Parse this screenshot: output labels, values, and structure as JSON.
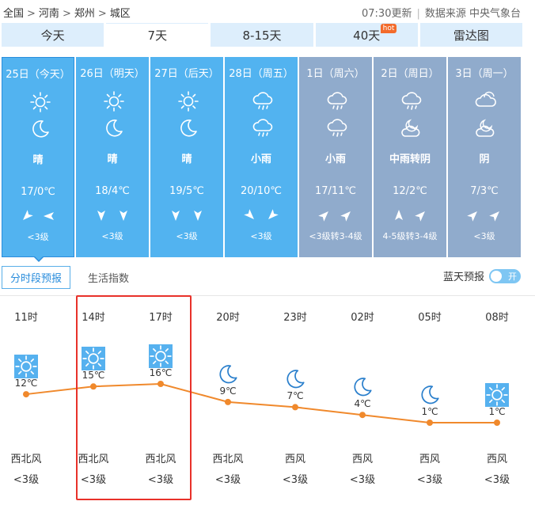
{
  "breadcrumb": [
    "全国",
    "河南",
    "郑州",
    "城区"
  ],
  "update_time": "07:30更新",
  "source": "数据来源 中央气象台",
  "tabs": [
    {
      "label": "今天",
      "active": false
    },
    {
      "label": "7天",
      "active": true
    },
    {
      "label": "8-15天",
      "active": false
    },
    {
      "label": "40天",
      "active": false,
      "badge": "hot"
    },
    {
      "label": "雷达图",
      "active": false
    }
  ],
  "days": [
    {
      "label": "25日（今天）",
      "icon_day": "sun-icon",
      "icon_night": "moon-icon",
      "weather": "晴",
      "temp": "17/0℃",
      "wind_dirs": [
        "sw-arrow",
        "w-arrow"
      ],
      "wind": "<3级"
    },
    {
      "label": "26日（明天）",
      "icon_day": "sun-icon",
      "icon_night": "moon-icon",
      "weather": "晴",
      "temp": "18/4℃",
      "wind_dirs": [
        "s-arrow",
        "s-arrow"
      ],
      "wind": "<3级"
    },
    {
      "label": "27日（后天）",
      "icon_day": "sun-icon",
      "icon_night": "moon-icon",
      "weather": "晴",
      "temp": "19/5℃",
      "wind_dirs": [
        "s-arrow",
        "s-arrow"
      ],
      "wind": "<3级"
    },
    {
      "label": "28日（周五）",
      "icon_day": "rain-icon",
      "icon_night": "rain-icon",
      "weather": "小雨",
      "temp": "20/10℃",
      "wind_dirs": [
        "se-arrow",
        "sw-arrow"
      ],
      "wind": "<3级"
    },
    {
      "label": "1日（周六）",
      "icon_day": "rain-icon",
      "icon_night": "rain-icon",
      "weather": "小雨",
      "temp": "17/11℃",
      "wind_dirs": [
        "ne-arrow",
        "ne-arrow"
      ],
      "wind": "<3级转3-4级"
    },
    {
      "label": "2日（周日）",
      "icon_day": "rain-icon",
      "icon_night": "cloudy-night-icon",
      "weather": "中雨转阴",
      "temp": "12/2℃",
      "wind_dirs": [
        "n-arrow",
        "ne-arrow"
      ],
      "wind": "4-5级转3-4级"
    },
    {
      "label": "3日（周一）",
      "icon_day": "cloud-icon",
      "icon_night": "cloudy-night-icon",
      "weather": "阴",
      "temp": "7/3℃",
      "wind_dirs": [
        "ne-arrow",
        "ne-arrow"
      ],
      "wind": "<3级"
    }
  ],
  "subtabs": [
    {
      "label": "分时段预报",
      "active": true
    },
    {
      "label": "生活指数",
      "active": false
    }
  ],
  "blue_sky": {
    "label": "蓝天预报",
    "toggle": "开"
  },
  "hourly": [
    {
      "time": "11时",
      "icon": "sun-icon",
      "temp": 12,
      "temp_label": "12℃",
      "dir": "西北风",
      "level": "<3级"
    },
    {
      "time": "14时",
      "icon": "sun-icon",
      "temp": 15,
      "temp_label": "15℃",
      "dir": "西北风",
      "level": "<3级"
    },
    {
      "time": "17时",
      "icon": "sun-icon",
      "temp": 16,
      "temp_label": "16℃",
      "dir": "西北风",
      "level": "<3级"
    },
    {
      "time": "20时",
      "icon": "moon-icon",
      "temp": 9,
      "temp_label": "9℃",
      "dir": "西北风",
      "level": "<3级"
    },
    {
      "time": "23时",
      "icon": "moon-icon",
      "temp": 7,
      "temp_label": "7℃",
      "dir": "西风",
      "level": "<3级"
    },
    {
      "time": "02时",
      "icon": "moon-icon",
      "temp": 4,
      "temp_label": "4℃",
      "dir": "西风",
      "level": "<3级"
    },
    {
      "time": "05时",
      "icon": "moon-icon",
      "temp": 1,
      "temp_label": "1℃",
      "dir": "西风",
      "level": "<3级"
    },
    {
      "time": "08时",
      "icon": "sun-icon",
      "temp": 1,
      "temp_label": "1℃",
      "dir": "西风",
      "level": "<3级"
    }
  ],
  "colors": {
    "line": "#f0892c",
    "point": "#f0892c",
    "tab_bg": "#ddeefc",
    "day_blue": "#52b3f0",
    "day_grey": "#90abcc",
    "highlight": "#e8312a"
  }
}
